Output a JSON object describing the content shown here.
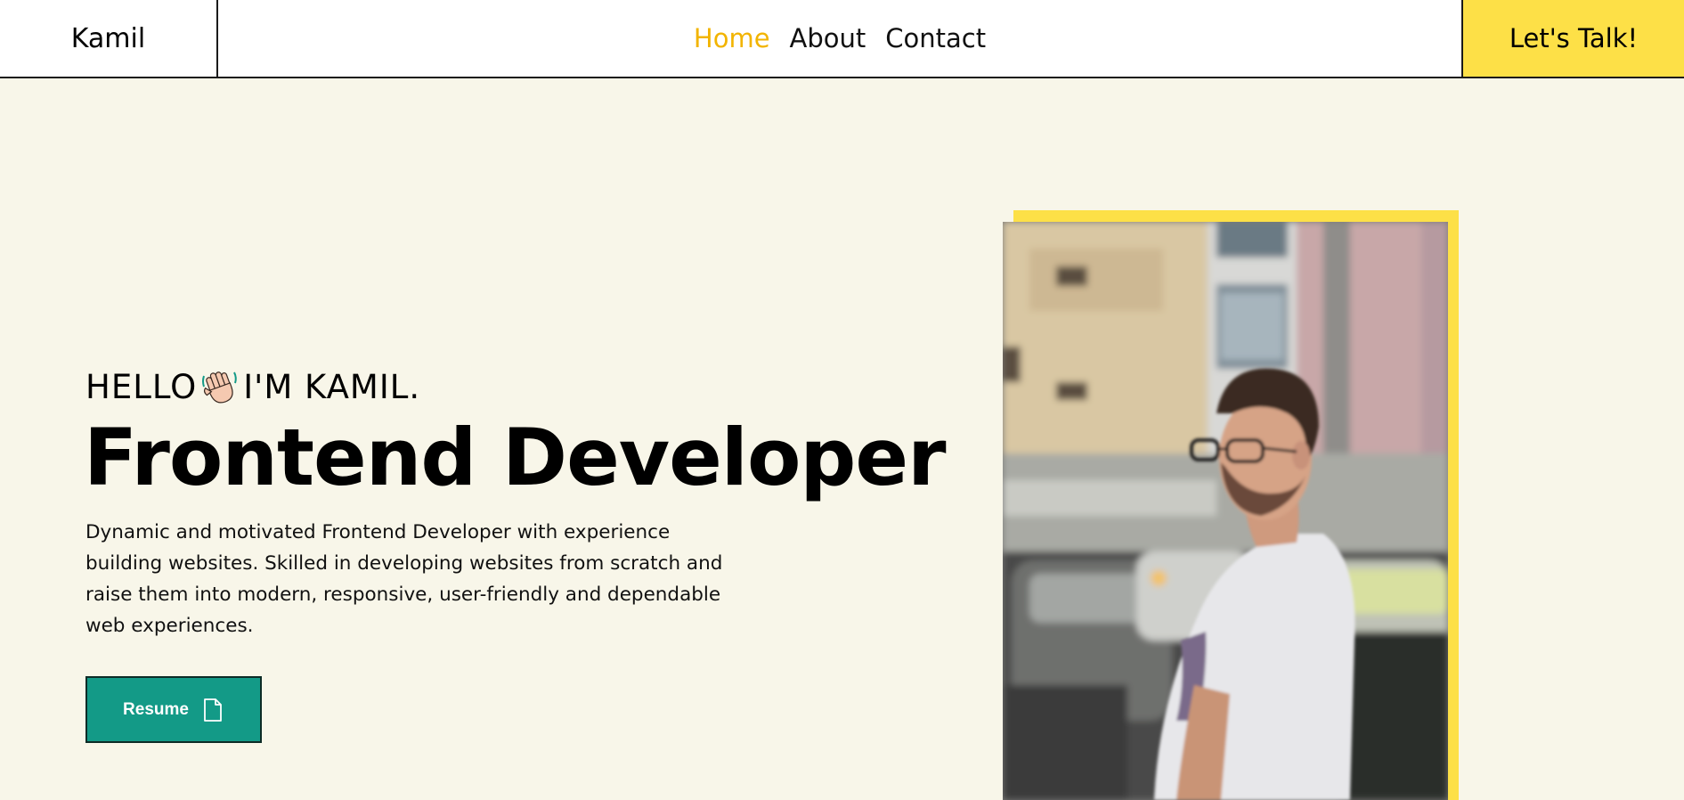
{
  "header": {
    "brand": "Kamil",
    "nav": [
      {
        "label": "Home",
        "active": true
      },
      {
        "label": "About",
        "active": false
      },
      {
        "label": "Contact",
        "active": false
      }
    ],
    "cta_label": "Let's Talk!"
  },
  "hero": {
    "greeting_before": "HELLO",
    "greeting_icon": "waving-hand-emoji",
    "greeting_after": "I'M KAMIL.",
    "title": "Frontend Developer",
    "description": "Dynamic and motivated Frontend Developer with experience building websites. Skilled in developing websites from scratch and raise them into modern, responsive, user-friendly and dependable web experiences.",
    "resume_label": "Resume",
    "resume_icon": "document-icon"
  },
  "colors": {
    "accent_yellow": "#fde047",
    "nav_active": "#f2b400",
    "button_teal": "#139a87",
    "page_bg": "#f8f6e9"
  }
}
